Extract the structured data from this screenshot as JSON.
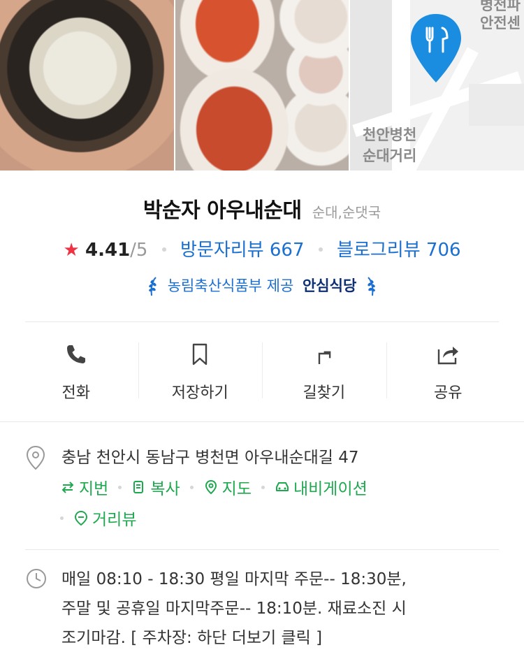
{
  "photos": {
    "map_labels": [
      "병천파",
      "안전센",
      "천안병천",
      "순대거리"
    ],
    "pin_color": "#1a8de0"
  },
  "place": {
    "name": "박순자 아우내순대",
    "category": "순대,순댓국"
  },
  "rating": {
    "star": "★",
    "score": "4.41",
    "max": "/5",
    "visitor_reviews": "방문자리뷰 667",
    "blog_reviews": "블로그리뷰 706",
    "star_color": "#ee3344",
    "link_color": "#1a6fd1"
  },
  "badge": {
    "provider": "농림축산식품부 제공",
    "title": "안심식당"
  },
  "actions": [
    {
      "label": "전화",
      "icon": "phone-icon"
    },
    {
      "label": "저장하기",
      "icon": "bookmark-icon"
    },
    {
      "label": "길찾기",
      "icon": "directions-icon"
    },
    {
      "label": "공유",
      "icon": "share-icon"
    }
  ],
  "address": {
    "text": "충남 천안시 동남구 병천면 아우내순대길 47",
    "links": [
      {
        "label": "지번",
        "icon": "swap-icon"
      },
      {
        "label": "복사",
        "icon": "copy-icon"
      },
      {
        "label": "지도",
        "icon": "map-pin-icon"
      },
      {
        "label": "내비게이션",
        "icon": "car-icon"
      },
      {
        "label": "거리뷰",
        "icon": "street-view-icon"
      }
    ],
    "link_color": "#1fa84f"
  },
  "hours": {
    "line1": "매일 08:10 - 18:30 평일 마지막 주문-- 18:30분,",
    "line2": "주말 및 공휴일 마지막주문-- 18:10분. 재료소진 시",
    "line3": "조기마감. [ 주차장: 하단 더보기 클릭 ]"
  }
}
